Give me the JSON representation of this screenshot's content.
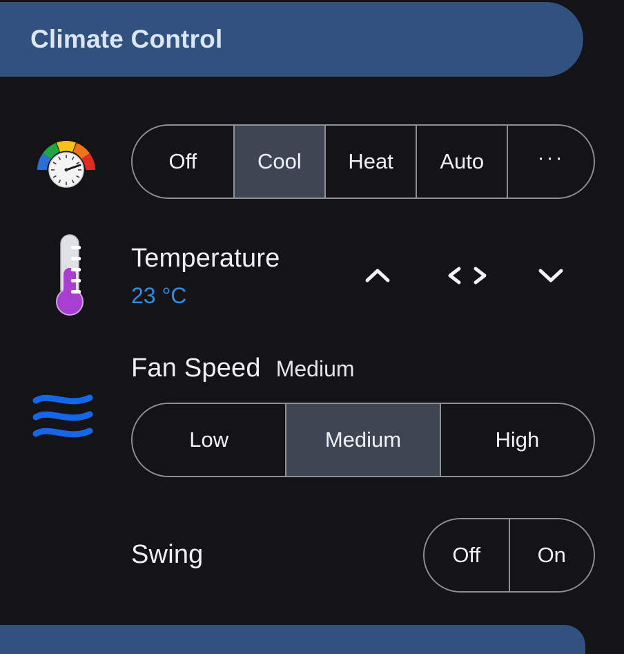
{
  "header": {
    "title": "Climate Control",
    "bar_color": "#31517f",
    "title_color": "#dbe6f5"
  },
  "theme": {
    "background": "#131318",
    "segment_border": "#8f9094",
    "selected_segment": "#3e4654",
    "accent_blue": "#2b8fe8",
    "text_primary": "#f0f0f2"
  },
  "mode": {
    "icon": "gauge-icon",
    "selected": "Cool",
    "options": [
      {
        "label": "Off",
        "selected": false
      },
      {
        "label": "Cool",
        "selected": true
      },
      {
        "label": "Heat",
        "selected": false
      },
      {
        "label": "Auto",
        "selected": false
      },
      {
        "label": "···",
        "selected": false
      }
    ]
  },
  "temperature": {
    "icon": "thermometer-icon",
    "label": "Temperature",
    "value": "23 °C",
    "actions": {
      "increase": "chevron-up-icon",
      "adjust": "chevron-left-right-icon",
      "decrease": "chevron-down-icon"
    }
  },
  "fan_speed": {
    "icon": "airflow-waves-icon",
    "label": "Fan Speed",
    "value": "Medium",
    "options": [
      {
        "label": "Low",
        "selected": false
      },
      {
        "label": "Medium",
        "selected": true
      },
      {
        "label": "High",
        "selected": false
      }
    ]
  },
  "swing": {
    "label": "Swing",
    "options": [
      {
        "label": "Off",
        "selected": false
      },
      {
        "label": "On",
        "selected": false
      }
    ]
  },
  "footer": {
    "bar_color": "#31517f"
  }
}
